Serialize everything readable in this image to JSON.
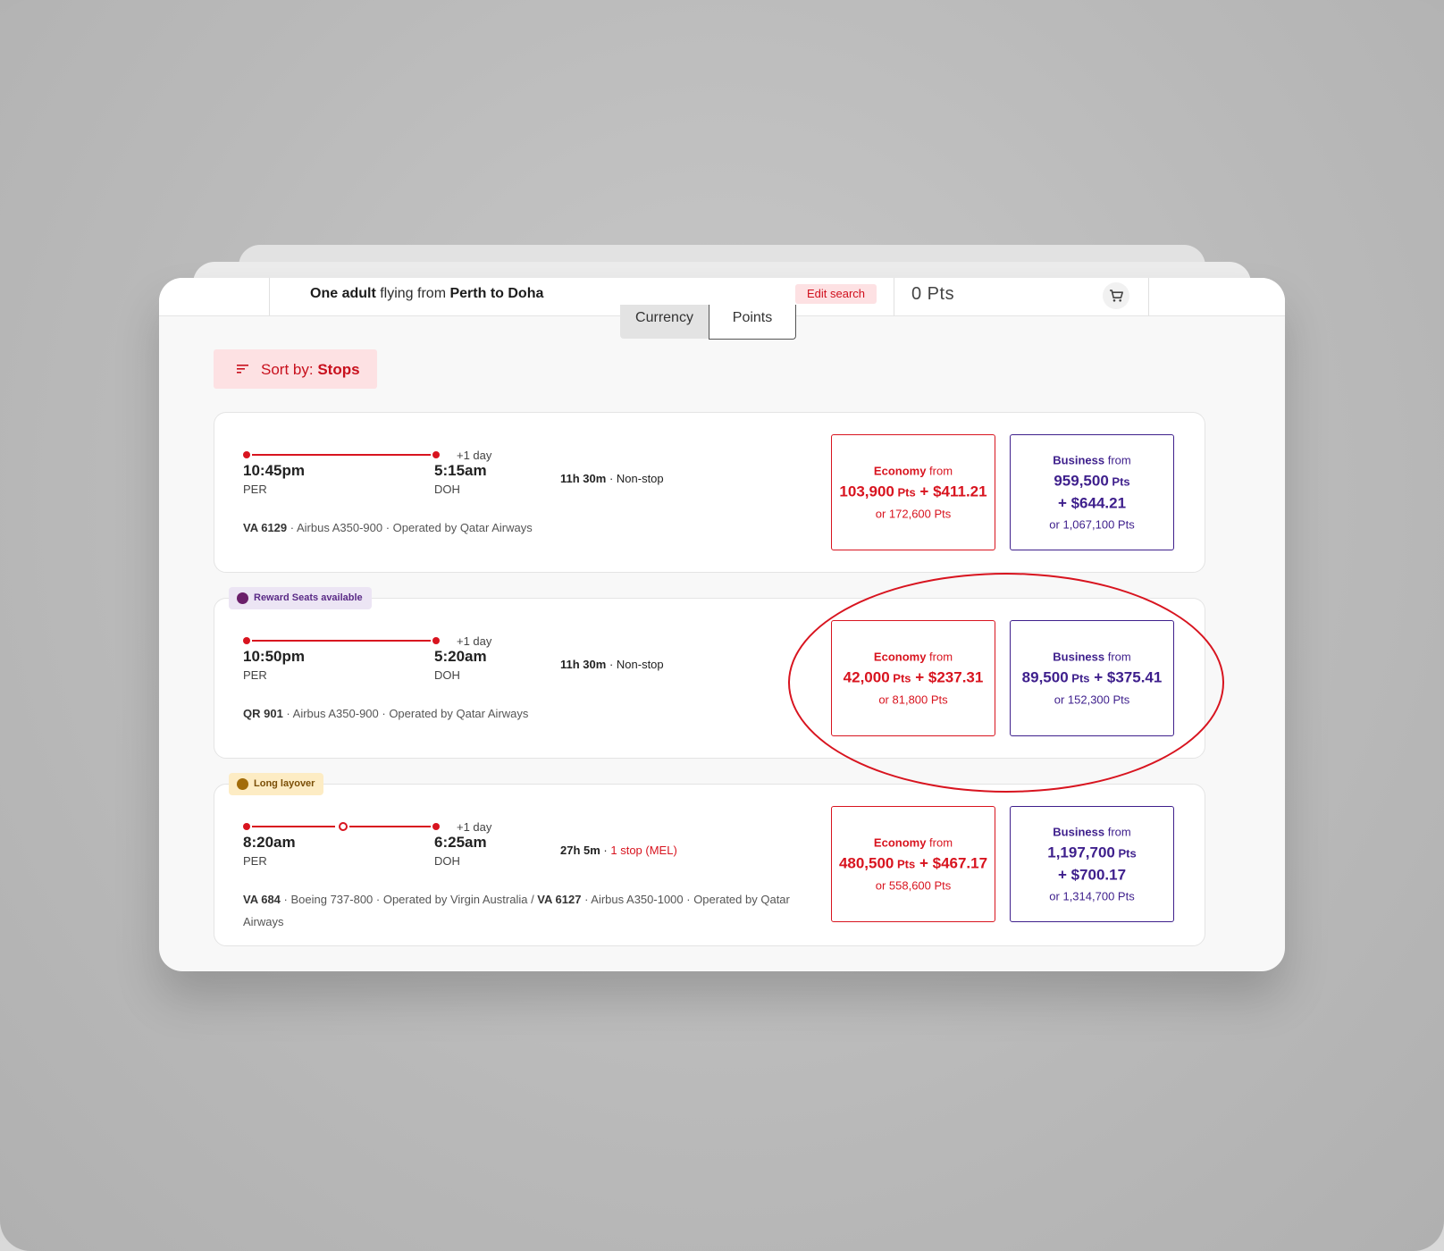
{
  "header": {
    "summary_prefix": "One adult",
    "summary_mid": " flying from ",
    "summary_route": "Perth to Doha",
    "edit_label": "Edit search",
    "points_total": "0  Pts",
    "cart_icon": "cart-icon"
  },
  "toggle": {
    "currency_label": "Currency",
    "points_label": "Points"
  },
  "sort": {
    "label": "Sort by: ",
    "value": "Stops",
    "icon": "sort-icon"
  },
  "colors": {
    "brand_red": "#d8141f",
    "business_purple": "#3e1f8c",
    "badge_reward_bg": "#ece5f4",
    "badge_layover_bg": "#fdecc4"
  },
  "flights": [
    {
      "badge": "",
      "dep_time": "10:45pm",
      "dep_code": "PER",
      "arr_time": "5:15am",
      "arr_code": "DOH",
      "plus_day": "+1 day",
      "duration": "11h 30m",
      "sep": " · ",
      "stops": "Non-stop",
      "flight_no": "VA 6129",
      "details": " · Airbus A350-900 · Operated by Qatar Airways",
      "economy": {
        "class": "Economy",
        "from": " from",
        "pts": "103,900",
        "pts_unit": " Pts",
        "cash": " + $411.21",
        "alt": "or 172,600 Pts"
      },
      "business": {
        "class": "Business",
        "from": " from",
        "pts": "959,500",
        "pts_unit": " Pts",
        "cash": "+ $644.21",
        "alt": "or 1,067,100 Pts"
      }
    },
    {
      "badge": "Reward Seats available",
      "dep_time": "10:50pm",
      "dep_code": "PER",
      "arr_time": "5:20am",
      "arr_code": "DOH",
      "plus_day": "+1 day",
      "duration": "11h 30m",
      "sep": " · ",
      "stops": "Non-stop",
      "flight_no": "QR 901",
      "details": " · Airbus A350-900 · Operated by Qatar Airways",
      "economy": {
        "class": "Economy",
        "from": " from",
        "pts": "42,000",
        "pts_unit": " Pts",
        "cash": " + $237.31",
        "alt": "or 81,800 Pts"
      },
      "business": {
        "class": "Business",
        "from": " from",
        "pts": "89,500",
        "pts_unit": " Pts",
        "cash": " + $375.41",
        "alt": "or 152,300 Pts"
      }
    },
    {
      "badge": "Long layover",
      "dep_time": "8:20am",
      "dep_code": "PER",
      "arr_time": "6:25am",
      "arr_code": "DOH",
      "plus_day": "+1 day",
      "duration": "27h 5m",
      "sep": " · ",
      "stops": "1 stop (MEL)",
      "flight_no": "VA 684",
      "details": " · Boeing 737-800 · Operated by Virgin Australia / ",
      "flight_no_2": "VA 6127",
      "details_2": " · Airbus A350-1000 · Operated by Qatar Airways",
      "economy": {
        "class": "Economy",
        "from": " from",
        "pts": "480,500",
        "pts_unit": " Pts",
        "cash": " + $467.17",
        "alt": "or 558,600 Pts"
      },
      "business": {
        "class": "Business",
        "from": " from",
        "pts": "1,197,700",
        "pts_unit": " Pts",
        "cash": "+ $700.17",
        "alt": "or 1,314,700 Pts"
      }
    }
  ]
}
